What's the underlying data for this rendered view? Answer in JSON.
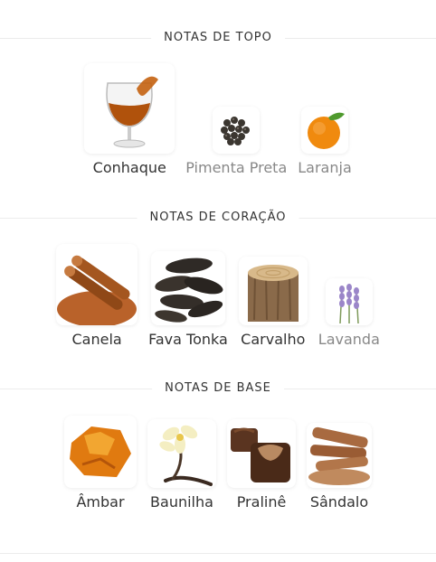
{
  "sections": {
    "top": {
      "title": "NOTAS DE TOPO",
      "notes": [
        {
          "label": "Conhaque",
          "icon": "cognac-glass-icon"
        },
        {
          "label": "Pimenta Preta",
          "icon": "black-pepper-icon"
        },
        {
          "label": "Laranja",
          "icon": "orange-icon"
        }
      ]
    },
    "heart": {
      "title": "NOTAS DE CORAÇÃO",
      "notes": [
        {
          "label": "Canela",
          "icon": "cinnamon-icon"
        },
        {
          "label": "Fava Tonka",
          "icon": "tonka-bean-icon"
        },
        {
          "label": "Carvalho",
          "icon": "oak-wood-icon"
        },
        {
          "label": "Lavanda",
          "icon": "lavender-icon"
        }
      ]
    },
    "base": {
      "title": "NOTAS DE BASE",
      "notes": [
        {
          "label": "Âmbar",
          "icon": "amber-icon"
        },
        {
          "label": "Baunilha",
          "icon": "vanilla-icon"
        },
        {
          "label": "Pralinê",
          "icon": "praline-icon"
        },
        {
          "label": "Sândalo",
          "icon": "sandalwood-icon"
        }
      ]
    }
  }
}
